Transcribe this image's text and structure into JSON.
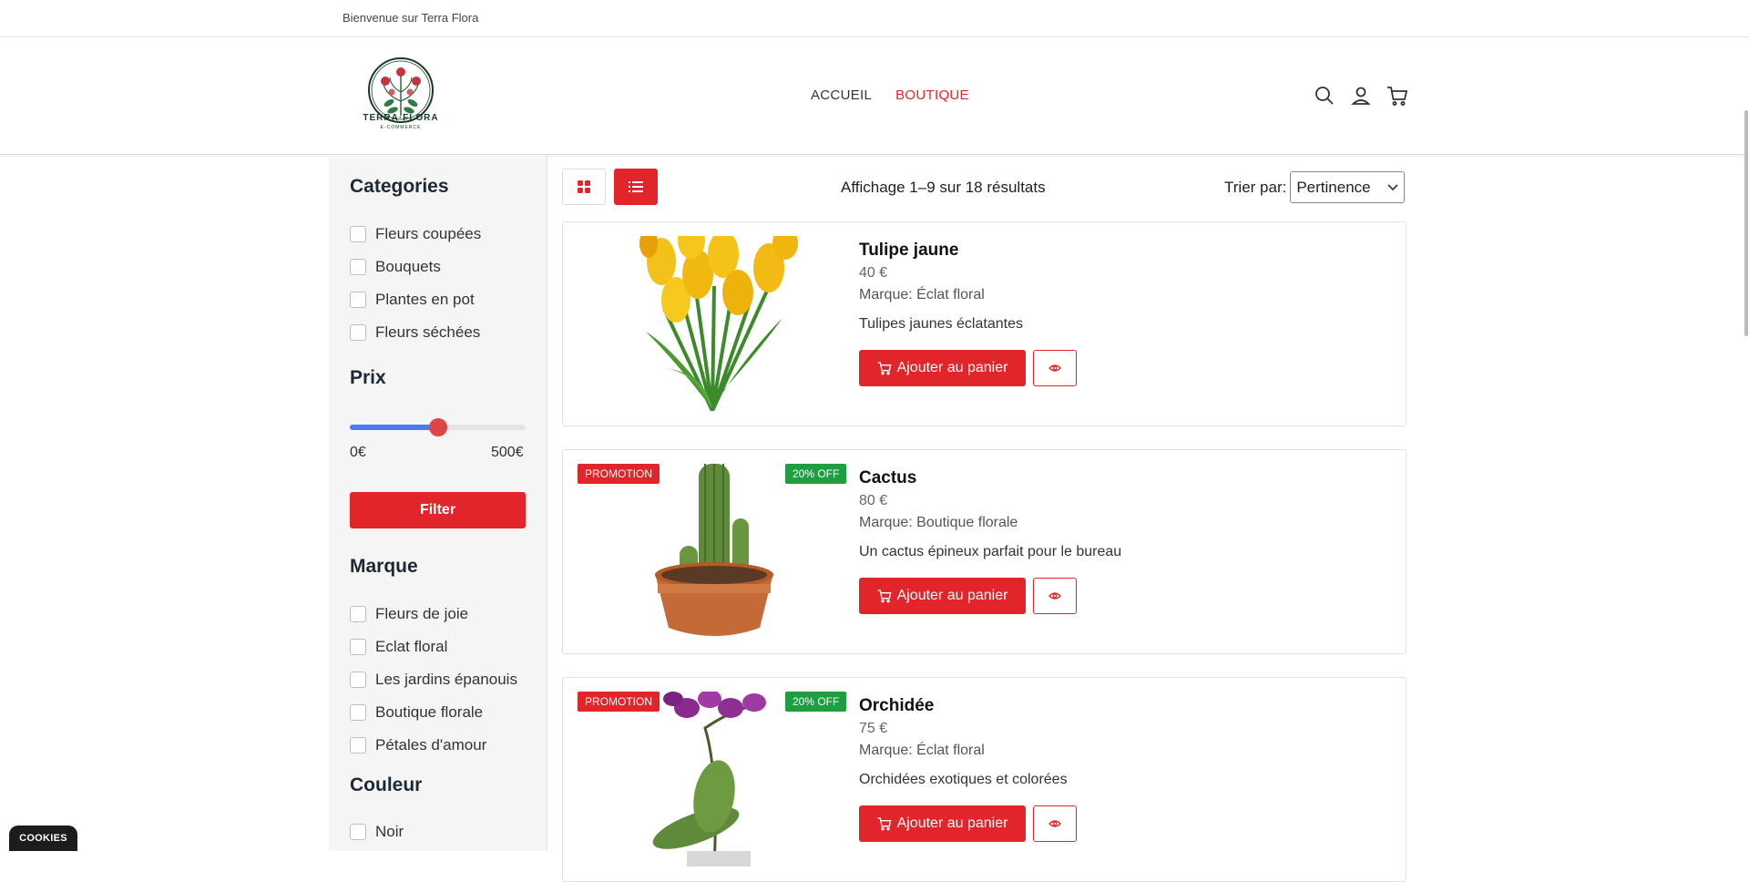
{
  "topbar": {
    "welcome": "Bienvenue sur Terra Flora"
  },
  "logo": {
    "line1": "TERRA·FLORA",
    "line2": "E-COMMERCE"
  },
  "nav": {
    "items": [
      {
        "label": "ACCUEIL",
        "active": false
      },
      {
        "label": "BOUTIQUE",
        "active": true
      }
    ]
  },
  "header_icons": [
    "search-icon",
    "user-icon",
    "cart-icon"
  ],
  "sidebar": {
    "categories_title": "Categories",
    "categories": [
      "Fleurs coupées",
      "Bouquets",
      "Plantes en pot",
      "Fleurs séchées"
    ],
    "price_title": "Prix",
    "price_min": "0€",
    "price_max": "500€",
    "price_slider_value": 0.5,
    "filter_label": "Filter",
    "brand_title": "Marque",
    "brands": [
      "Fleurs de joie",
      "Eclat floral",
      "Les jardins épanouis",
      "Boutique florale",
      "Pétales d'amour"
    ],
    "color_title": "Couleur",
    "colors": [
      "Noir"
    ]
  },
  "toolbar": {
    "results": "Affichage 1–9 sur 18 résultats",
    "sort_label": "Trier par:",
    "sort_value": "Pertinence"
  },
  "products": [
    {
      "name": "Tulipe jaune",
      "price": "40 €",
      "brand": "Marque: Éclat floral",
      "desc": "Tulipes jaunes éclatantes",
      "promo": "",
      "discount": ""
    },
    {
      "name": "Cactus",
      "price": "80 €",
      "brand": "Marque: Boutique florale",
      "desc": "Un cactus épineux parfait pour le bureau",
      "promo": "PROMOTION",
      "discount": "20% OFF"
    },
    {
      "name": "Orchidée",
      "price": "75 €",
      "brand": "Marque: Éclat floral",
      "desc": "Orchidées exotiques et colorées",
      "promo": "PROMOTION",
      "discount": "20% OFF"
    }
  ],
  "add_to_cart_label": "Ajouter au panier",
  "cookies_label": "COOKIES",
  "colors": {
    "accent": "#e2252b",
    "discount": "#1f9d41",
    "slider": "#4b7cf5"
  }
}
